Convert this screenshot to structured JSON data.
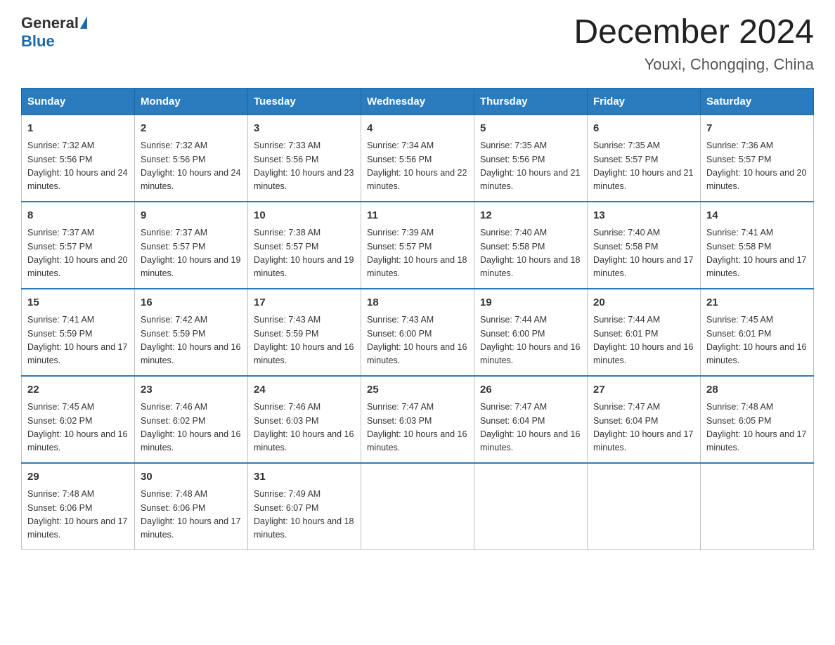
{
  "header": {
    "logo_general": "General",
    "logo_blue": "Blue",
    "month_title": "December 2024",
    "location": "Youxi, Chongqing, China"
  },
  "days_of_week": [
    "Sunday",
    "Monday",
    "Tuesday",
    "Wednesday",
    "Thursday",
    "Friday",
    "Saturday"
  ],
  "weeks": [
    [
      {
        "day": "1",
        "sunrise": "7:32 AM",
        "sunset": "5:56 PM",
        "daylight": "10 hours and 24 minutes."
      },
      {
        "day": "2",
        "sunrise": "7:32 AM",
        "sunset": "5:56 PM",
        "daylight": "10 hours and 24 minutes."
      },
      {
        "day": "3",
        "sunrise": "7:33 AM",
        "sunset": "5:56 PM",
        "daylight": "10 hours and 23 minutes."
      },
      {
        "day": "4",
        "sunrise": "7:34 AM",
        "sunset": "5:56 PM",
        "daylight": "10 hours and 22 minutes."
      },
      {
        "day": "5",
        "sunrise": "7:35 AM",
        "sunset": "5:56 PM",
        "daylight": "10 hours and 21 minutes."
      },
      {
        "day": "6",
        "sunrise": "7:35 AM",
        "sunset": "5:57 PM",
        "daylight": "10 hours and 21 minutes."
      },
      {
        "day": "7",
        "sunrise": "7:36 AM",
        "sunset": "5:57 PM",
        "daylight": "10 hours and 20 minutes."
      }
    ],
    [
      {
        "day": "8",
        "sunrise": "7:37 AM",
        "sunset": "5:57 PM",
        "daylight": "10 hours and 20 minutes."
      },
      {
        "day": "9",
        "sunrise": "7:37 AM",
        "sunset": "5:57 PM",
        "daylight": "10 hours and 19 minutes."
      },
      {
        "day": "10",
        "sunrise": "7:38 AM",
        "sunset": "5:57 PM",
        "daylight": "10 hours and 19 minutes."
      },
      {
        "day": "11",
        "sunrise": "7:39 AM",
        "sunset": "5:57 PM",
        "daylight": "10 hours and 18 minutes."
      },
      {
        "day": "12",
        "sunrise": "7:40 AM",
        "sunset": "5:58 PM",
        "daylight": "10 hours and 18 minutes."
      },
      {
        "day": "13",
        "sunrise": "7:40 AM",
        "sunset": "5:58 PM",
        "daylight": "10 hours and 17 minutes."
      },
      {
        "day": "14",
        "sunrise": "7:41 AM",
        "sunset": "5:58 PM",
        "daylight": "10 hours and 17 minutes."
      }
    ],
    [
      {
        "day": "15",
        "sunrise": "7:41 AM",
        "sunset": "5:59 PM",
        "daylight": "10 hours and 17 minutes."
      },
      {
        "day": "16",
        "sunrise": "7:42 AM",
        "sunset": "5:59 PM",
        "daylight": "10 hours and 16 minutes."
      },
      {
        "day": "17",
        "sunrise": "7:43 AM",
        "sunset": "5:59 PM",
        "daylight": "10 hours and 16 minutes."
      },
      {
        "day": "18",
        "sunrise": "7:43 AM",
        "sunset": "6:00 PM",
        "daylight": "10 hours and 16 minutes."
      },
      {
        "day": "19",
        "sunrise": "7:44 AM",
        "sunset": "6:00 PM",
        "daylight": "10 hours and 16 minutes."
      },
      {
        "day": "20",
        "sunrise": "7:44 AM",
        "sunset": "6:01 PM",
        "daylight": "10 hours and 16 minutes."
      },
      {
        "day": "21",
        "sunrise": "7:45 AM",
        "sunset": "6:01 PM",
        "daylight": "10 hours and 16 minutes."
      }
    ],
    [
      {
        "day": "22",
        "sunrise": "7:45 AM",
        "sunset": "6:02 PM",
        "daylight": "10 hours and 16 minutes."
      },
      {
        "day": "23",
        "sunrise": "7:46 AM",
        "sunset": "6:02 PM",
        "daylight": "10 hours and 16 minutes."
      },
      {
        "day": "24",
        "sunrise": "7:46 AM",
        "sunset": "6:03 PM",
        "daylight": "10 hours and 16 minutes."
      },
      {
        "day": "25",
        "sunrise": "7:47 AM",
        "sunset": "6:03 PM",
        "daylight": "10 hours and 16 minutes."
      },
      {
        "day": "26",
        "sunrise": "7:47 AM",
        "sunset": "6:04 PM",
        "daylight": "10 hours and 16 minutes."
      },
      {
        "day": "27",
        "sunrise": "7:47 AM",
        "sunset": "6:04 PM",
        "daylight": "10 hours and 17 minutes."
      },
      {
        "day": "28",
        "sunrise": "7:48 AM",
        "sunset": "6:05 PM",
        "daylight": "10 hours and 17 minutes."
      }
    ],
    [
      {
        "day": "29",
        "sunrise": "7:48 AM",
        "sunset": "6:06 PM",
        "daylight": "10 hours and 17 minutes."
      },
      {
        "day": "30",
        "sunrise": "7:48 AM",
        "sunset": "6:06 PM",
        "daylight": "10 hours and 17 minutes."
      },
      {
        "day": "31",
        "sunrise": "7:49 AM",
        "sunset": "6:07 PM",
        "daylight": "10 hours and 18 minutes."
      },
      null,
      null,
      null,
      null
    ]
  ]
}
